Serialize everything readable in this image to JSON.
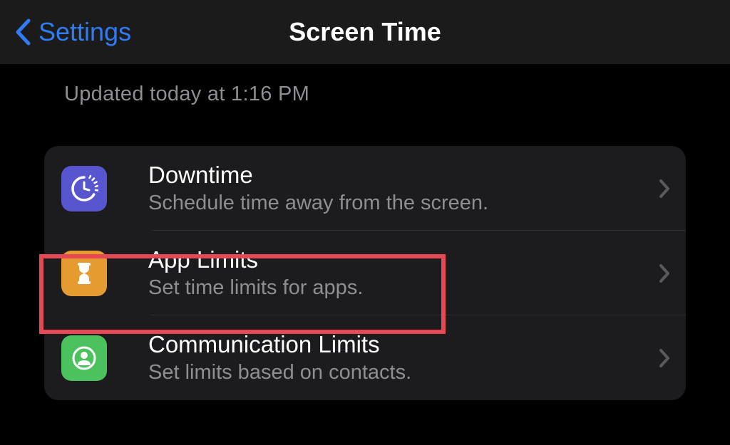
{
  "nav": {
    "back_label": "Settings",
    "title": "Screen Time"
  },
  "status": {
    "updated": "Updated today at 1:16 PM"
  },
  "items": [
    {
      "title": "Downtime",
      "subtitle": "Schedule time away from the screen."
    },
    {
      "title": "App Limits",
      "subtitle": "Set time limits for apps."
    },
    {
      "title": "Communication Limits",
      "subtitle": "Set limits based on contacts."
    }
  ],
  "colors": {
    "accent": "#2f7cf6",
    "highlight": "#e74856",
    "downtime": "#5856ce",
    "applimits": "#e69b30",
    "commlimits": "#4cc25e"
  }
}
